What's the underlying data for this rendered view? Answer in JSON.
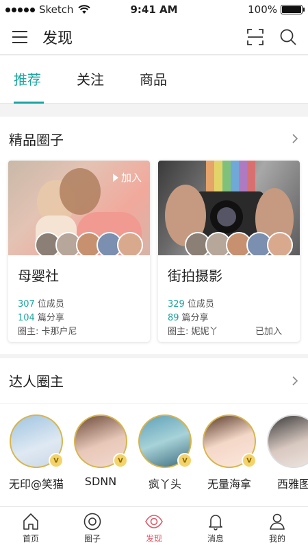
{
  "status_bar": {
    "carrier": "Sketch",
    "time": "9:41 AM",
    "battery": "100%",
    "battery_level": 1.0
  },
  "nav": {
    "title": "发现",
    "icons": [
      "menu-icon",
      "scan-icon",
      "search-icon"
    ]
  },
  "tabs": [
    {
      "label": "推荐",
      "active": true
    },
    {
      "label": "关注",
      "active": false
    },
    {
      "label": "商品",
      "active": false
    }
  ],
  "circles": {
    "title": "精品圈子",
    "items": [
      {
        "name": "母婴社",
        "members_count": "307",
        "members_label": "位成员",
        "shares_count": "104",
        "shares_label": "篇分享",
        "owner": "圈主: 卡那户尼",
        "join_label": "加入",
        "status": ""
      },
      {
        "name": "街拍摄影",
        "members_count": "329",
        "members_label": "位成员",
        "shares_count": "89",
        "shares_label": "篇分享",
        "owner": "圈主: 妮妮丫",
        "join_label": "",
        "status": "已加入"
      }
    ]
  },
  "experts": {
    "title": "达人圈主",
    "items": [
      {
        "name": "无印@笑猫",
        "badge": "V"
      },
      {
        "name": "SDNN",
        "badge": "V"
      },
      {
        "name": "疯丫头",
        "badge": "V"
      },
      {
        "name": "无量海拿",
        "badge": "V"
      },
      {
        "name": "西雅图",
        "badge": ""
      }
    ]
  },
  "tab_bar": [
    {
      "label": "首页",
      "icon": "home-icon",
      "active": false
    },
    {
      "label": "圈子",
      "icon": "circle-icon",
      "active": false
    },
    {
      "label": "发现",
      "icon": "eye-icon",
      "active": true
    },
    {
      "label": "消息",
      "icon": "bell-icon",
      "active": false
    },
    {
      "label": "我的",
      "icon": "user-icon",
      "active": false
    }
  ],
  "colors": {
    "accent": "#1aa59f",
    "active_tab": "#e05a6a",
    "vip_gold": "#f4d46a"
  }
}
